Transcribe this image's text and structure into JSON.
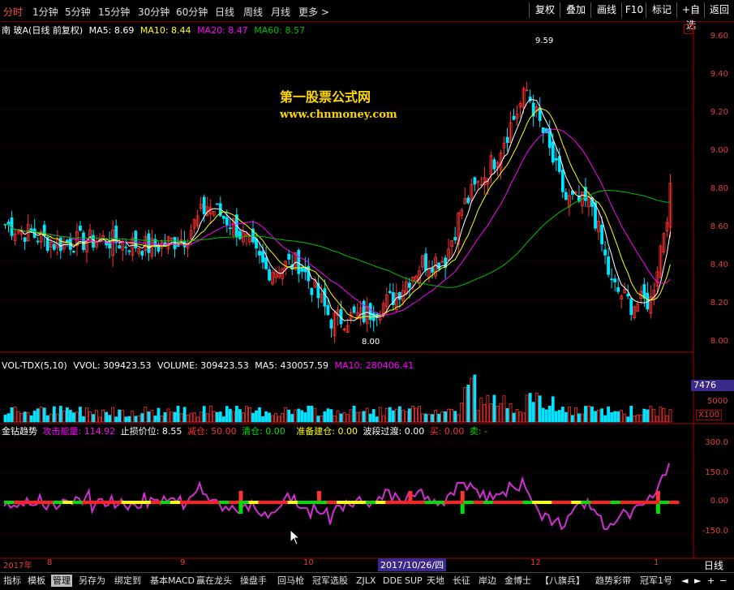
{
  "toolbar": {
    "periods": [
      "分时",
      "1分钟",
      "5分钟",
      "15分钟",
      "30分钟",
      "60分钟",
      "日线",
      "周线",
      "月线",
      "更多 >"
    ],
    "right_buttons": [
      "复权",
      "叠加",
      "画线",
      "F10",
      "标记",
      "+自选",
      "返回"
    ]
  },
  "stock": {
    "name": "南 玻A",
    "mode": "(日线 前复权)",
    "ma5": "MA5: 8.69",
    "ma10": "MA10: 8.44",
    "ma20": "MA20: 8.47",
    "ma60": "MA60: 8.57"
  },
  "watermark": {
    "title": "第一股票公式网",
    "url": "www.chnmoney.com"
  },
  "price_axis": [
    "9.60",
    "9.40",
    "9.20",
    "9.00",
    "8.80",
    "8.60",
    "8.40",
    "8.20",
    "8.00"
  ],
  "price_marks": {
    "high": "9.59",
    "low": "8.00"
  },
  "volume": {
    "title": "VOL-TDX(5,10)",
    "vvol": "VVOL: 309423.53",
    "volume": "VOLUME: 309423.53",
    "ma5": "MA5: 430057.59",
    "ma10": "MA10: 280406.41",
    "current": "7476",
    "axis": "5000",
    "unit": "X100"
  },
  "indicator": {
    "title": "金钻趋势",
    "attack": "攻击能量: 114.92",
    "stop": "止损价位: 8.55",
    "reduce": "减仓: 50.00",
    "clear": "清仓: 0.00",
    "prep": "准备建仓: 0.00",
    "wave": "波段过渡: 0.00",
    "buy": "买: 0.00",
    "sell": "卖: -",
    "axis": [
      "300.0",
      "150.0",
      "0.00",
      "-150.0"
    ]
  },
  "dates": {
    "year": "2017年",
    "m8": "8",
    "m9": "9",
    "m10": "10",
    "m12": "12",
    "m1": "1",
    "tip": "2017/10/26/四",
    "period": "日线"
  },
  "bottom_tabs": [
    "指标",
    "模板",
    "管理",
    "另存为",
    "绑定到",
    "基本MACD",
    "赢在龙头",
    "操盘手",
    "回马枪",
    "冠军选股",
    "ZJLX",
    "DDE",
    "SUP",
    "天地",
    "长征",
    "岸边",
    "金博士",
    "【八旗兵】",
    "趋势彩带",
    "冠军1号"
  ],
  "colors": {
    "up": "#ff3232",
    "down": "#00e4ff",
    "ma5": "#ffffff",
    "ma10": "#ffff00",
    "ma20": "#ff00ff",
    "ma60": "#00c000",
    "border": "#aa0000"
  }
}
